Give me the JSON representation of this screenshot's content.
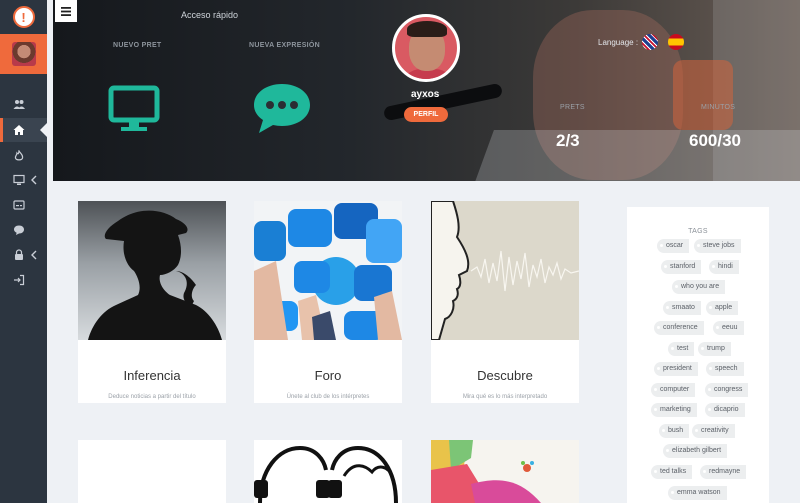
{
  "header": {
    "quick_access": "Acceso rápido",
    "nuevo_pret": "NUEVO PRET",
    "nueva_expresion": "NUEVA EXPRESIÓN",
    "username": "ayxos",
    "perfil_label": "PERFIL",
    "language_label": "Language :",
    "stats": [
      {
        "label": "PRETS",
        "value": "2/3"
      },
      {
        "label": "MINUTOS",
        "value": "600/30"
      }
    ]
  },
  "sidebar": {
    "items": [
      {
        "icon": "users-icon"
      },
      {
        "icon": "home-icon",
        "active": true
      },
      {
        "icon": "fire-icon"
      },
      {
        "icon": "monitor-icon",
        "has_submenu": true
      },
      {
        "icon": "subtitles-icon"
      },
      {
        "icon": "chat-icon"
      },
      {
        "icon": "lock-icon",
        "has_submenu": true
      },
      {
        "icon": "logout-icon"
      }
    ]
  },
  "cards": [
    {
      "title": "Inferencia",
      "desc": "Deduce noticias a partir del título"
    },
    {
      "title": "Foro",
      "desc": "Únete al club de los intérpretes"
    },
    {
      "title": "Descubre",
      "desc": "Mira qué es lo más interpretado"
    }
  ],
  "tags": {
    "title": "TAGS",
    "items": [
      "oscar",
      "steve jobs",
      "stanford",
      "hindi",
      "who you are",
      "smaato",
      "apple",
      "conference",
      "eeuu",
      "test",
      "trump",
      "president",
      "speech",
      "computer",
      "congress",
      "marketing",
      "dicaprio",
      "bush",
      "creativity",
      "elizabeth gilbert",
      "ted talks",
      "redmayne",
      "emma watson"
    ]
  },
  "colors": {
    "accent": "#ef6a3c",
    "sidebar": "#2c3540",
    "teal": "#1fb89b"
  }
}
